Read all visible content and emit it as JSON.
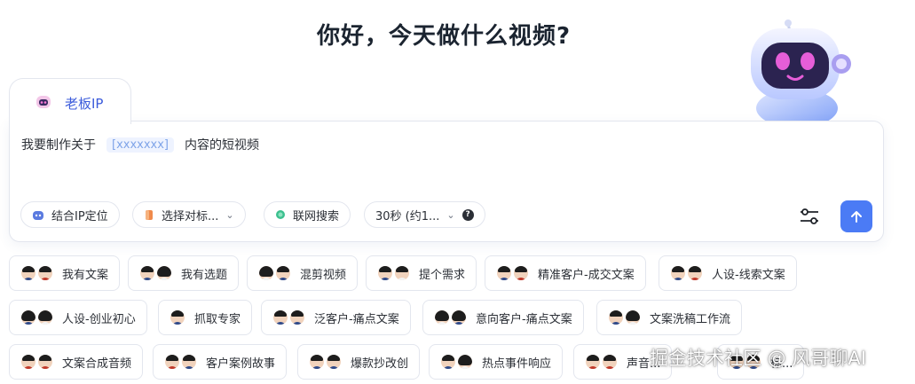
{
  "header": {
    "title": "你好，今天做什么视频?"
  },
  "tab": {
    "label": "老板IP",
    "icon": "robot-icon"
  },
  "prompt": {
    "prefix": "我要制作关于",
    "placeholder": "[xxxxxxx]",
    "suffix": "内容的短视频"
  },
  "toolbar": {
    "ip_position": "结合IP定位",
    "select_target": "选择对标...",
    "web_search": "联网搜索",
    "duration": "30秒 (约1...",
    "help": "?"
  },
  "colors": {
    "accent": "#4b7bf5",
    "tab_text": "#3b5bdb",
    "border": "#e3e6ee"
  },
  "templates": [
    {
      "label": "我有文案"
    },
    {
      "label": "我有选题"
    },
    {
      "label": "混剪视频"
    },
    {
      "label": "提个需求"
    },
    {
      "label": "精准客户-成交文案"
    },
    {
      "label": "人设-线索文案"
    },
    {
      "label": "人设-创业初心"
    },
    {
      "label": "抓取专家"
    },
    {
      "label": "泛客户-痛点文案"
    },
    {
      "label": "意向客户-痛点文案"
    },
    {
      "label": "文案洗稿工作流"
    },
    {
      "label": "文案合成音频"
    },
    {
      "label": "客户案例故事"
    },
    {
      "label": "爆款抄改创"
    },
    {
      "label": "热点事件响应"
    },
    {
      "label": "声音..."
    },
    {
      "label": "标..."
    }
  ],
  "watermark": "掘金技术社区 @ 风哥聊AI"
}
